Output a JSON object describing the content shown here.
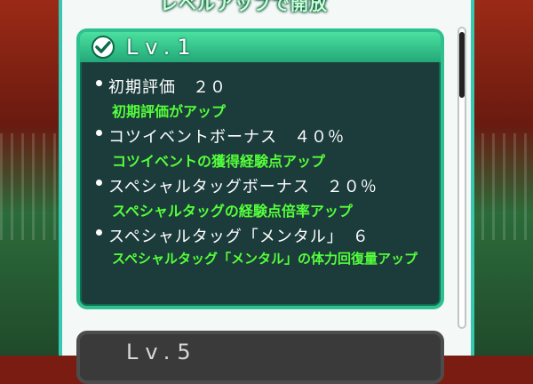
{
  "header": {
    "title": "レベルアップで開放"
  },
  "card": {
    "level_label": "Lv.1",
    "items": [
      {
        "name": "初期評価　２０",
        "desc": "初期評価がアップ"
      },
      {
        "name": "コツイベントボーナス　４０％",
        "desc": "コツイベントの獲得経験点アップ"
      },
      {
        "name": "スペシャルタッグボーナス　２０％",
        "desc": "スペシャルタッグの経験点倍率アップ"
      },
      {
        "name": "スペシャルタッグ「メンタル」　６",
        "desc": "スペシャルタッグ「メンタル」の体力回復量アップ"
      }
    ]
  },
  "next_card": {
    "level_label": "Lv.5"
  },
  "icons": {
    "header": "check-icon"
  },
  "colors": {
    "accent": "#2fc08f",
    "desc_text": "#54ff3a",
    "card_bg": "#1c3b3b"
  }
}
